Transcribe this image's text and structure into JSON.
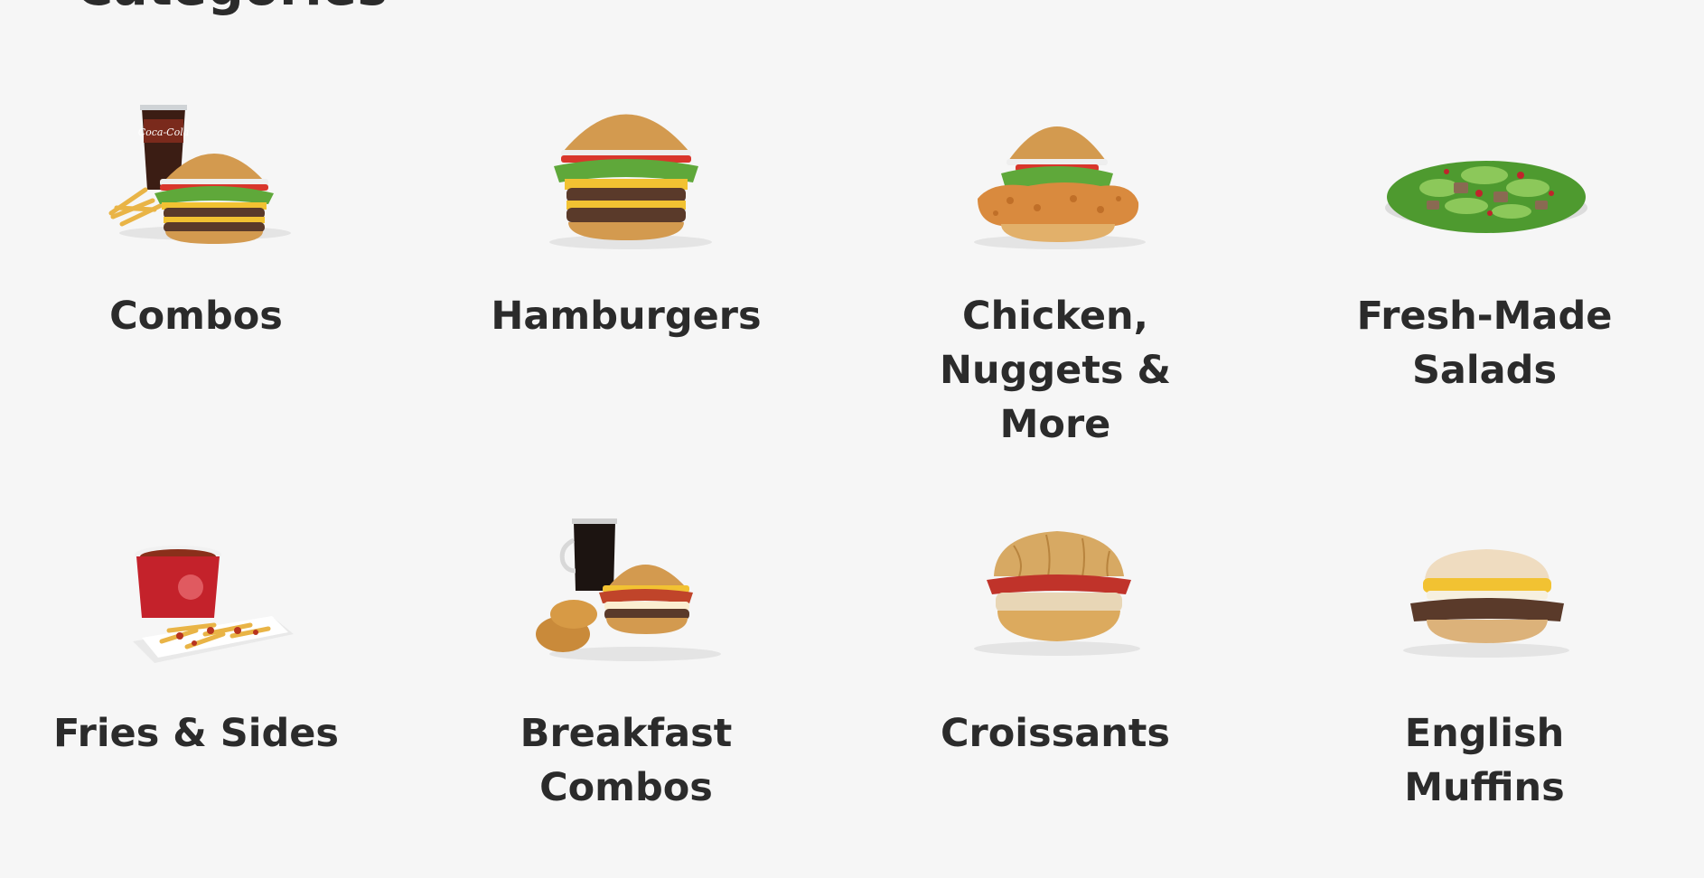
{
  "section": {
    "title": "Categories"
  },
  "categories": [
    {
      "label": "Combos",
      "icon": "combo-meal-icon"
    },
    {
      "label": "Hamburgers",
      "icon": "hamburger-icon"
    },
    {
      "label": "Chicken, Nuggets & More",
      "icon": "chicken-sandwich-icon"
    },
    {
      "label": "Fresh-Made Salads",
      "icon": "salad-icon"
    },
    {
      "label": "Fries & Sides",
      "icon": "chili-fries-icon"
    },
    {
      "label": "Breakfast Combos",
      "icon": "breakfast-combo-icon"
    },
    {
      "label": "Croissants",
      "icon": "croissant-sandwich-icon"
    },
    {
      "label": "English Muffins",
      "icon": "english-muffin-icon"
    }
  ],
  "colors": {
    "background": "#f6f6f6",
    "text": "#2b2b2b",
    "bun": "#d39a4f",
    "patty": "#5a3a2a",
    "cheese": "#f2c232",
    "lettuce": "#5fa83a",
    "tomato": "#d9362b",
    "cup_red": "#c4222b"
  }
}
